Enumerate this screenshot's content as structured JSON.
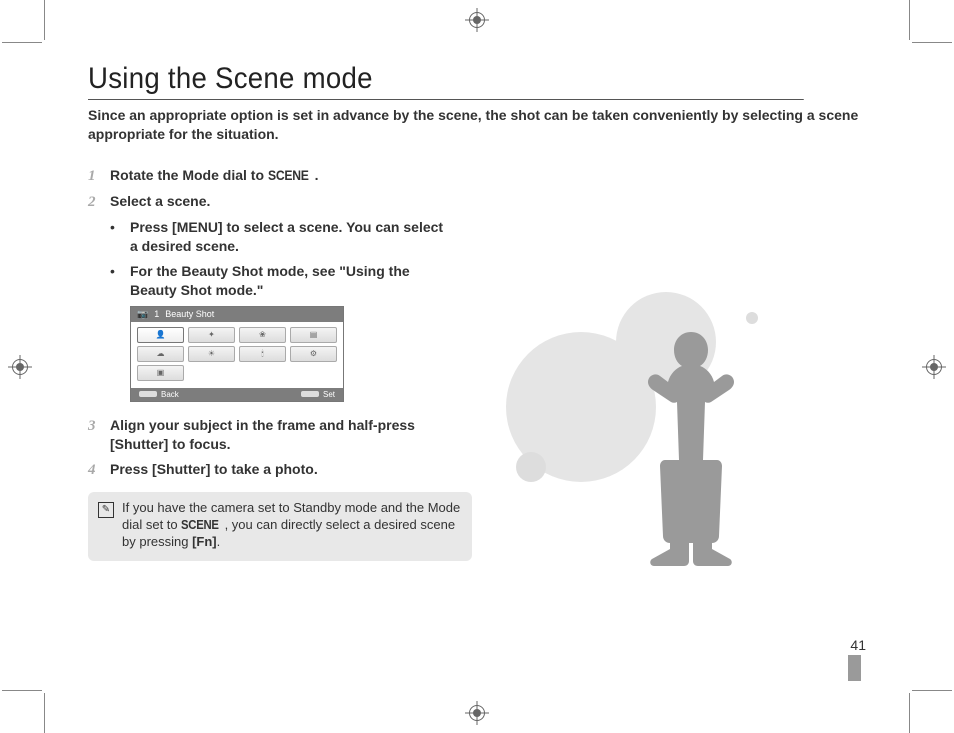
{
  "title": "Using the Scene mode",
  "subtitle": "Since an appropriate option is set in advance by the scene, the shot can be taken conveniently by selecting a scene appropriate for the situation.",
  "steps": {
    "s1_num": "1",
    "s1_prefix": "Rotate the Mode dial to ",
    "s1_scene": "SCENE",
    "s1_suffix": ".",
    "s2_num": "2",
    "s2_text": "Select a scene.",
    "s3_num": "3",
    "s3_text_a": "Align your subject in the frame and half-press ",
    "s3_text_b": "[Shutter]",
    "s3_text_c": " to focus.",
    "s4_num": "4",
    "s4_text_a": "Press ",
    "s4_text_b": "[Shutter]",
    "s4_text_c": " to take a photo."
  },
  "bullets": {
    "b1_a": "Press ",
    "b1_b": "[MENU]",
    "b1_c": " to select a scene. You can select a desired scene.",
    "b2": "For the Beauty Shot mode, see \"Using the Beauty Shot mode.\""
  },
  "menu": {
    "header_num": "1",
    "header_label": "Beauty Shot",
    "footer_back": "Back",
    "footer_set": "Set"
  },
  "note": {
    "text_a": "If you have the camera set to Standby mode and the Mode dial set to ",
    "scene": "SCENE",
    "text_b": ", you can directly select a desired scene by pressing ",
    "fn": "[Fn]",
    "text_c": "."
  },
  "page_number": "41"
}
